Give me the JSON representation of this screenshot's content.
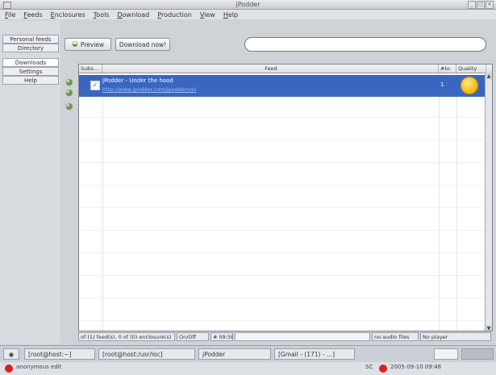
{
  "window": {
    "title": "jPodder"
  },
  "menu": [
    "File",
    "Feeds",
    "Enclosures",
    "Tools",
    "Download",
    "Production",
    "View",
    "Help"
  ],
  "nav": {
    "items": [
      {
        "label": "Personal feeds"
      },
      {
        "label": "Directory"
      },
      {
        "label": "Downloads"
      },
      {
        "label": "Settings"
      },
      {
        "label": "Help"
      }
    ]
  },
  "toolbar": {
    "preview_label": "Preview",
    "download_label": "Download now!"
  },
  "table": {
    "headers": {
      "subscribe": "Subs...",
      "feed": "Feed",
      "count": "#to",
      "quality": "Quality"
    },
    "rows": [
      {
        "title": "jPodder - Under the hood",
        "url": "http://www.jpodder.com/jpodderxml",
        "count": "1",
        "checked": true
      }
    ]
  },
  "status": {
    "summary": "of (1) feed(s), 0 of (0) enclosure(s)",
    "onoff": "On/Off",
    "time": "# 09:58",
    "player_status": "no audio files",
    "player": "No player"
  },
  "taskbar": {
    "tasks": [
      {
        "label": "[root@host:~]"
      },
      {
        "label": "[root@host:/usr/loc]"
      },
      {
        "label": "jPodder"
      },
      {
        "label": "[Gmail - (171) - ...]"
      }
    ]
  },
  "bottom": {
    "left_text": "anonymous  edit",
    "sc": "SC",
    "clock": "2005-09-10 09:48"
  },
  "colors": {
    "selection": "#3a66c2",
    "link": "#9cc0ff",
    "accent": "#6f9a4b"
  }
}
